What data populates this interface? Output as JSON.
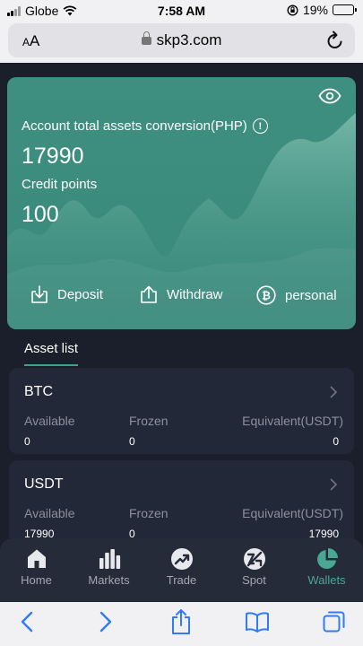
{
  "status_bar": {
    "carrier": "Globe",
    "time": "7:58 AM",
    "battery_percent": "19%",
    "battery_level": 0.19
  },
  "browser": {
    "text_size_button": "AA",
    "url": "skp3.com"
  },
  "asset_card": {
    "conversion_label": "Account total assets conversion(PHP)",
    "total_value": "17990",
    "credit_label": "Credit points",
    "credit_value": "100",
    "actions": {
      "deposit": "Deposit",
      "withdraw": "Withdraw",
      "personal": "personal"
    }
  },
  "tabs": {
    "asset_list": "Asset list"
  },
  "assets": [
    {
      "name": "BTC",
      "available_label": "Available",
      "frozen_label": "Frozen",
      "equivalent_label": "Equivalent(USDT)",
      "available": "0",
      "frozen": "0",
      "equivalent": "0"
    },
    {
      "name": "USDT",
      "available_label": "Available",
      "frozen_label": "Frozen",
      "equivalent_label": "Equivalent(USDT)",
      "available": "17990",
      "frozen": "0",
      "equivalent": "17990"
    }
  ],
  "bottom_nav": [
    {
      "label": "Home",
      "icon": "home-icon"
    },
    {
      "label": "Markets",
      "icon": "markets-bars-icon"
    },
    {
      "label": "Trade",
      "icon": "trade-arrow-icon"
    },
    {
      "label": "Spot",
      "icon": "spot-icon"
    },
    {
      "label": "Wallets",
      "icon": "wallet-pie-icon",
      "active": true
    }
  ],
  "colors": {
    "accent": "#49a794",
    "card": "#3e8f80",
    "background": "#1b1f2b",
    "panel": "#232838"
  }
}
